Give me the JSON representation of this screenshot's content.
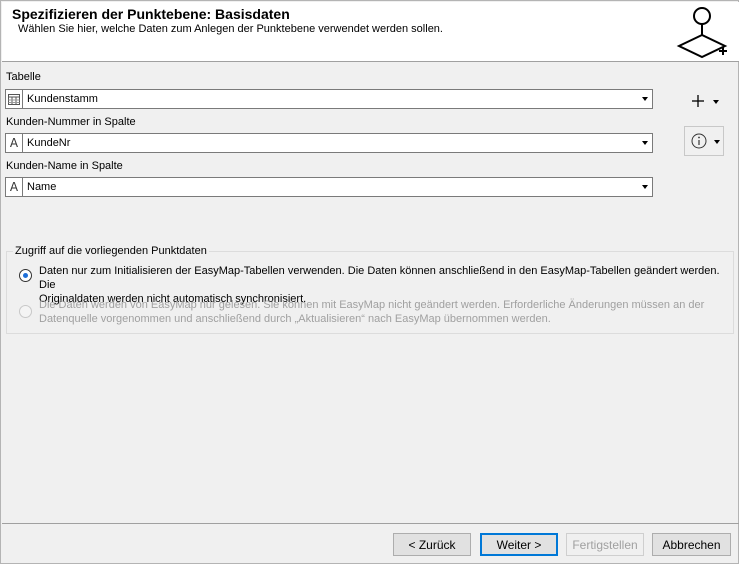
{
  "header": {
    "title": "Spezifizieren der Punktebene: Basisdaten",
    "subtitle": "Wählen Sie hier, welche Daten zum Anlegen der Punktebene verwendet werden sollen.",
    "icon": "point-layer-add-icon"
  },
  "fields": {
    "table": {
      "label": "Tabelle",
      "value": "Kundenstamm",
      "icon": "table-icon"
    },
    "customer_number": {
      "label": "Kunden-Nummer in Spalte",
      "value": "KundeNr",
      "icon": "text-column-icon",
      "icon_text": "A"
    },
    "customer_name": {
      "label": "Kunden-Name in Spalte",
      "value": "Name",
      "icon": "text-column-icon",
      "icon_text": "A"
    }
  },
  "side_buttons": {
    "add_icon": "plus-icon",
    "info_icon": "info-icon"
  },
  "access_group": {
    "title": "Zugriff auf die vorliegenden Punktdaten",
    "option1_line1": "Daten nur zum Initialisieren der EasyMap-Tabellen verwenden. Die Daten können anschließend in den EasyMap-Tabellen geändert werden. Die",
    "option1_line2": "Originaldaten werden nicht automatisch synchronisiert.",
    "option1_selected": true,
    "option2_line1": "Die Daten werden von EasyMap nur gelesen. Sie können mit EasyMap nicht geändert werden. Erforderliche Änderungen müssen an der",
    "option2_line2": "Datenquelle vorgenommen und anschließend durch „Aktualisieren“ nach EasyMap übernommen werden.",
    "option2_enabled": false
  },
  "footer": {
    "back": "< Zurück",
    "next": "Weiter >",
    "finish": "Fertigstellen",
    "cancel": "Abbrechen"
  },
  "colors": {
    "accent": "#0078d7",
    "radio_dot": "#1e6fd9",
    "disabled_text": "#a0a0a0"
  }
}
